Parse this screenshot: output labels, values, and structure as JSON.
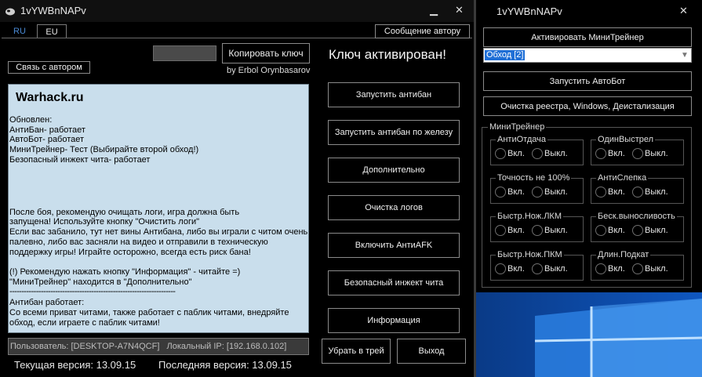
{
  "main": {
    "title": "1vYWBnNAPv",
    "controls": {
      "minimize": "▁",
      "close": "✕"
    },
    "tabs": [
      {
        "label": "RU"
      },
      {
        "label": "EU"
      }
    ],
    "message_author_btn": "Сообщение автору",
    "contact_author_btn": "Связь с автором",
    "copy_key_btn": "Копировать ключ",
    "author_credit": "by Erbol Orynbasarov",
    "key_status": "Ключ активирован!",
    "info_title": "Warhack.ru",
    "info_lines": [
      "Обновлен:",
      "АнтиБан- работает",
      "АвтоБот- работает",
      "МиниТрейнер- Тест (Выбирайте второй обход!)",
      "Безопасный инжект чита- работает",
      "",
      "",
      "",
      "",
      "После боя, рекомендую очищать логи, игра должна быть",
      "запущена! Используйте кнопку \"Очистить логи\"",
      "Если вас забанило, тут нет вины Антибана, либо вы играли с читом очень",
      "палевно, либо вас засняли на видео и отправили в техническую",
      "поддержку игры! Играйте осторожно, всегда есть риск бана!",
      "",
      "(!) Рекомендую нажать кнопку \"Информация\" - читайте =)",
      "\"МиниТрейнер\" находится в \"Дополнительно\"",
      "---------------------------------------------------------------------",
      "Антибан работает:",
      "Со всеми приват читами, также работает с паблик читами, внедряйте",
      "обход, если играете с паблик читами!"
    ],
    "actions": [
      "Запустить антибан",
      "Запустить антибан по железу",
      "Дополнительно",
      "Очистка логов",
      "Включить АнтиAFK",
      "Безопасный инжект чита",
      "Информация"
    ],
    "tray_btn": "Убрать в трей",
    "exit_btn": "Выход",
    "status": "Пользователь: [DESKTOP-A7N4QCF]   Локальный IP: [192.168.0.102]",
    "current_version": "Текущая версия: 13.09.15",
    "latest_version": "Последняя версия: 13.09.15"
  },
  "side": {
    "title": "1vYWBnNAPv",
    "close": "✕",
    "activate_btn": "Активировать МиниТрейнер",
    "bypass_select": "Обход [2]",
    "autobot_btn": "Запустить АвтоБот",
    "clean_btn": "Очистка реестра, Windows, Деистализация",
    "trainer_group": "МиниТрейнер",
    "on_label": "Вкл.",
    "off_label": "Выкл.",
    "options": [
      "АнтиОтдача",
      "ОдинВыстрел",
      "Точность не 100%",
      "АнтиСлепка",
      "Быстр.Нож.ЛКМ",
      "Беск.выносливость",
      "Быстр.Нож.ПКМ",
      "Длин.Подкат"
    ]
  }
}
